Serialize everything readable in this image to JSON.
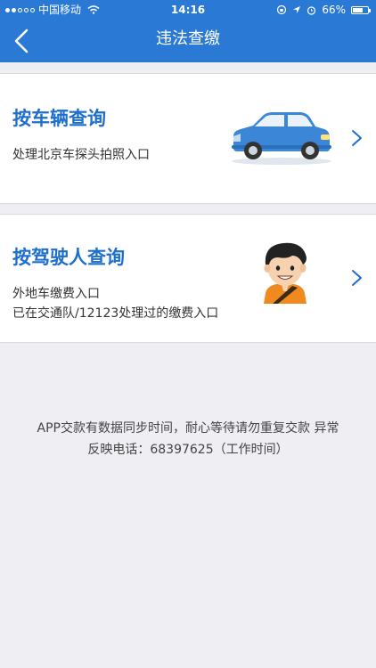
{
  "status_bar": {
    "carrier": "中国移动",
    "time": "14:16",
    "battery": "66%",
    "battery_level": 0.66
  },
  "nav": {
    "title": "违法查缴"
  },
  "cards": [
    {
      "title": "按车辆查询",
      "lines": [
        "处理北京车探头拍照入口"
      ]
    },
    {
      "title": "按驾驶人查询",
      "lines": [
        "外地车缴费入口",
        "已在交通队/12123处理过的缴费入口"
      ]
    }
  ],
  "footer": {
    "line1": "APP交款有数据同步时间，耐心等待请勿重复交款 异常",
    "line2": "反映电话：68397625（工作时间）"
  }
}
